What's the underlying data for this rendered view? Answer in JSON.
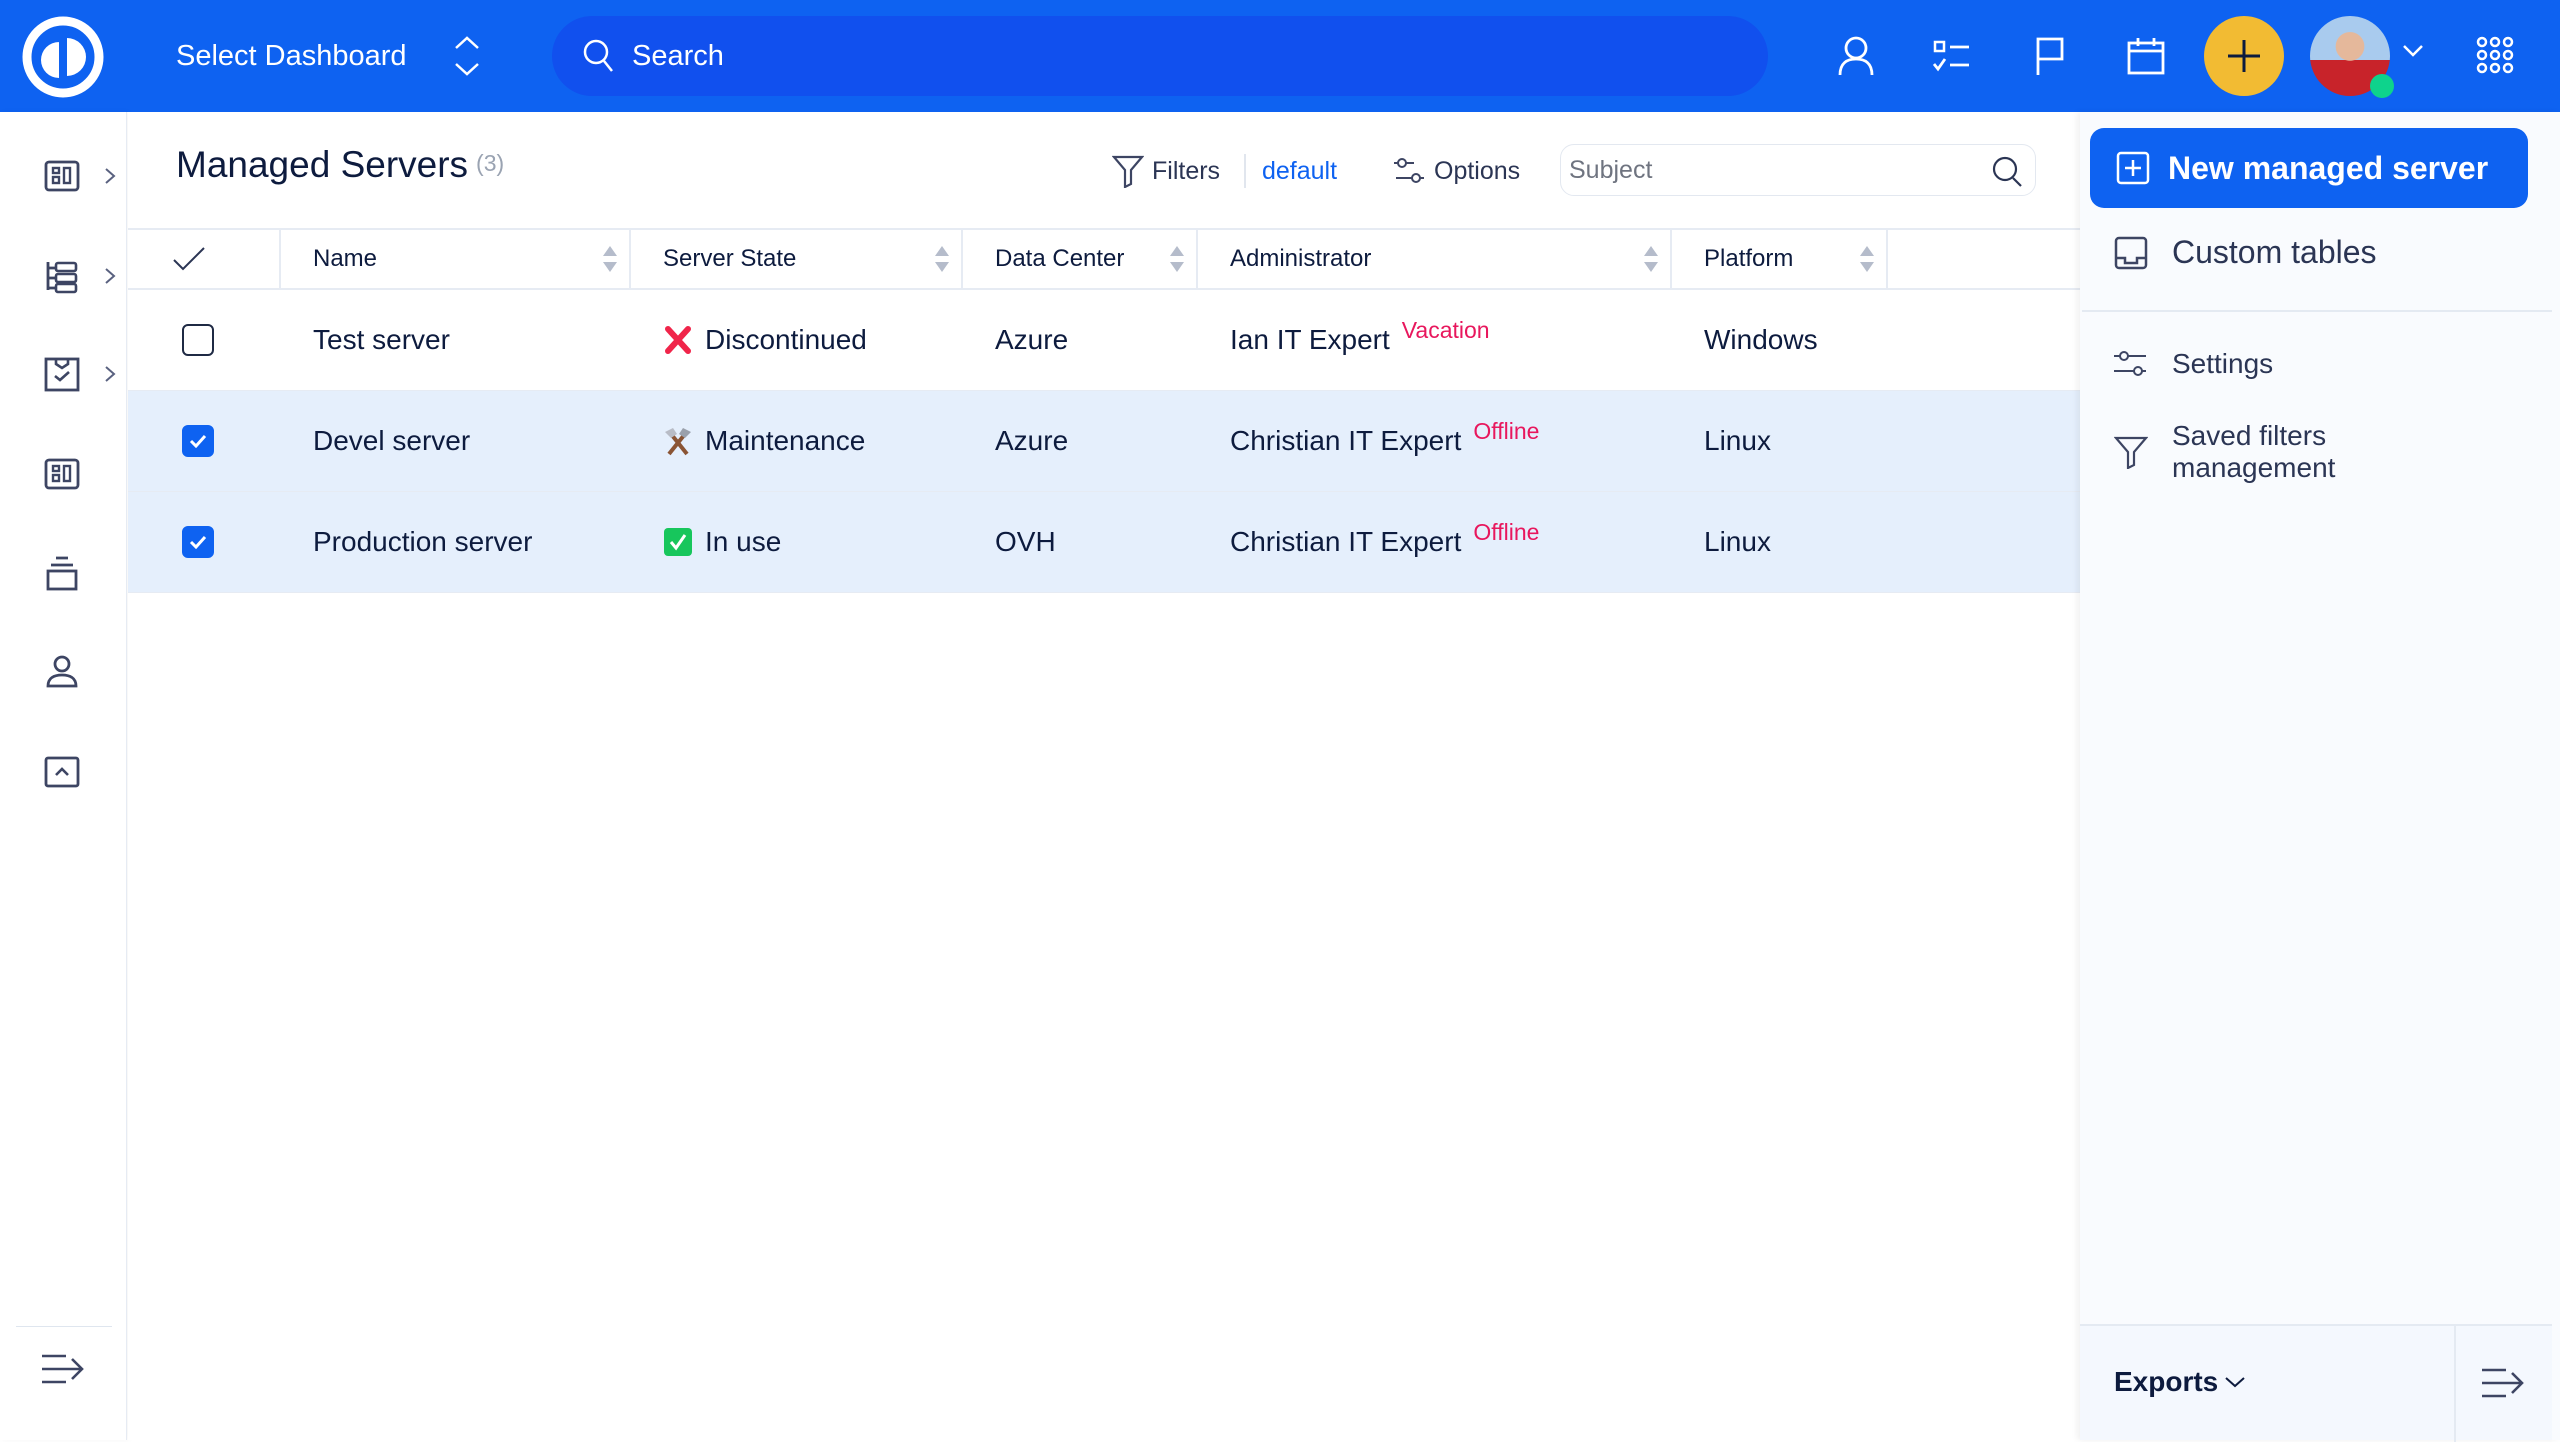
{
  "topbar": {
    "dashboard_label": "Select Dashboard",
    "search_placeholder": "Search",
    "icons": [
      "logo-icon",
      "updown-icon",
      "search-icon",
      "user-icon",
      "tasks-icon",
      "flag-icon",
      "calendar-icon",
      "plus-icon",
      "avatar",
      "chevron-down-icon",
      "apps-grid-icon"
    ],
    "colors": {
      "bar": "#0e62f1",
      "search": "#1150ee",
      "plus": "#f2bb33",
      "online": "#0ed38c"
    }
  },
  "sidebar": {
    "items": [
      {
        "icon": "dashboard-icon",
        "has_submenu": true
      },
      {
        "icon": "hierarchy-icon",
        "has_submenu": true
      },
      {
        "icon": "clipboard-check-icon",
        "has_submenu": true
      },
      {
        "icon": "dashboard-icon",
        "has_submenu": false
      },
      {
        "icon": "stack-icon",
        "has_submenu": false
      },
      {
        "icon": "user-icon",
        "has_submenu": false
      },
      {
        "icon": "collapse-up-icon",
        "has_submenu": false
      }
    ],
    "collapse_icon": "expand-menu-icon"
  },
  "main": {
    "title": "Managed Servers",
    "count": "(3)",
    "toolbar": {
      "filters_label": "Filters",
      "filter_name": "default",
      "options_label": "Options",
      "subject_placeholder": "Subject"
    },
    "table": {
      "columns": [
        "Name",
        "Server State",
        "Data Center",
        "Administrator",
        "Platform"
      ],
      "rows": [
        {
          "selected": false,
          "name": "Test server",
          "state": "Discontinued",
          "state_icon": "cross-mark-icon",
          "data_center": "Azure",
          "administrator": "Ian IT Expert",
          "admin_status": "Vacation",
          "platform": "Windows"
        },
        {
          "selected": true,
          "name": "Devel server",
          "state": "Maintenance",
          "state_icon": "hammer-pick-icon",
          "data_center": "Azure",
          "administrator": "Christian IT Expert",
          "admin_status": "Offline",
          "platform": "Linux"
        },
        {
          "selected": true,
          "name": "Production server",
          "state": "In use",
          "state_icon": "check-box-icon",
          "data_center": "OVH",
          "administrator": "Christian IT Expert",
          "admin_status": "Offline",
          "platform": "Linux"
        }
      ],
      "colors": {
        "selected_row": "#e5effc",
        "status_badge": "#e8175d"
      }
    }
  },
  "rightpanel": {
    "new_button": "New managed server",
    "custom_tables": "Custom tables",
    "settings": "Settings",
    "saved_filters_line1": "Saved filters",
    "saved_filters_line2": "management",
    "exports": "Exports"
  }
}
